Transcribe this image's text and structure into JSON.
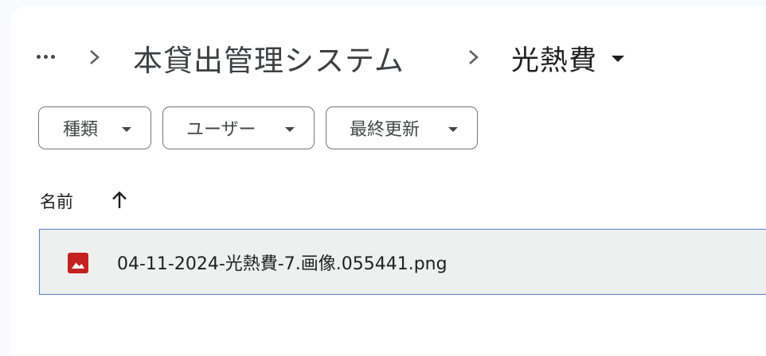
{
  "breadcrumb": {
    "more_label": "…",
    "parent": "本貸出管理システム",
    "current": "光熱費"
  },
  "filters": [
    {
      "label": "種類"
    },
    {
      "label": "ユーザー"
    },
    {
      "label": "最終更新"
    }
  ],
  "list": {
    "column_header": "名前",
    "sort_direction": "ascending",
    "files": [
      {
        "name": "04-11-2024-光熱費-7.画像.055441.png",
        "type_icon": "image-icon",
        "icon_color": "#c5221f"
      }
    ]
  },
  "colors": {
    "page_background": "#f8fafd",
    "panel": "#ffffff",
    "selected_row": "#eef0ef",
    "selected_border": "#5b7bc9",
    "image_icon": "#c5221f"
  }
}
